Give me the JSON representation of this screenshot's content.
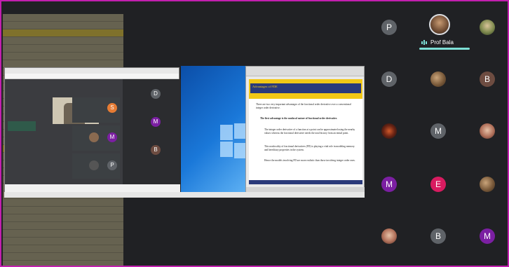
{
  "speaker": {
    "name": "Prof Bala"
  },
  "slide": {
    "title": "Advantages of FDE",
    "intro": "There are two very important advantages of the fractional order derivative over a conventional integer order derivative.",
    "heading": "The first advantage is the nonlocal nature of fractional order derivative.",
    "bullets": [
      "The integer order derivative of a function at a point can be approximated using the nearby values whereas the fractional derivative needs the total history from an initial point.",
      "This nonlocality of fractional derivatives (FD) is playing a vital role in modeling memory and hereditary properties in the system.",
      "Hence the models involving FD are more realistic than those involving integer order ones."
    ]
  },
  "participants": [
    {
      "letter": "P",
      "color": "#5f6368",
      "kind": "letter"
    },
    {
      "letter": "",
      "color": "",
      "kind": "photo-green"
    },
    {
      "letter": "D",
      "color": "#5f6368",
      "kind": "letter"
    },
    {
      "letter": "",
      "color": "",
      "kind": "photo"
    },
    {
      "letter": "B",
      "color": "#6d4c41",
      "kind": "letter"
    },
    {
      "letter": "",
      "color": "",
      "kind": "photo-dark"
    },
    {
      "letter": "M",
      "color": "#5f6368",
      "kind": "letter"
    },
    {
      "letter": "",
      "color": "",
      "kind": "photo-pink"
    },
    {
      "letter": "M",
      "color": "#7b1fa2",
      "kind": "letter"
    },
    {
      "letter": "E",
      "color": "#d81b60",
      "kind": "letter"
    },
    {
      "letter": "",
      "color": "",
      "kind": "photo"
    },
    {
      "letter": "",
      "color": "",
      "kind": "photo-pink"
    },
    {
      "letter": "B",
      "color": "#5f6368",
      "kind": "letter"
    },
    {
      "letter": "M",
      "color": "#7b1fa2",
      "kind": "letter"
    }
  ],
  "inner_tiles": [
    {
      "letter": "S",
      "color": "#e67c34"
    },
    {
      "letter": "D",
      "color": "#5f6368"
    },
    {
      "letter": "M",
      "color": "#7b1fa2"
    },
    {
      "letter": "M",
      "color": "#7b1fa2"
    },
    {
      "letter": "P",
      "color": "#5f6368"
    },
    {
      "letter": "B",
      "color": "#6d4c41"
    }
  ]
}
